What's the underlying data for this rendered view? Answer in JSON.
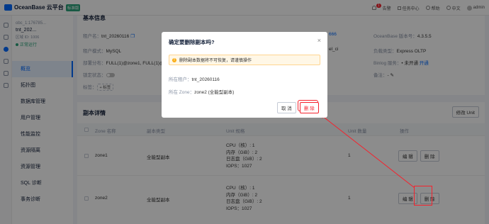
{
  "topbar": {
    "brand": "OceanBase 云平台",
    "edition": "标准版",
    "alerts_label": "告警",
    "alerts_count": "1",
    "tasks_label": "任务中心",
    "help_label": "帮助",
    "lang_label": "中文",
    "user_label": "admin"
  },
  "tenant": {
    "cluster": "obc_1:176785...",
    "name": "tnt_202...",
    "region": "区域 ID: 1006",
    "status": "正常运行"
  },
  "nav": [
    "概览",
    "拓扑图",
    "数据库管理",
    "用户管理",
    "性能监控",
    "资源隔离",
    "资源管理",
    "SQL 诊断",
    "事务诊断"
  ],
  "basic": {
    "section_title": "基本信息",
    "tenant_name_key": "租户名：",
    "tenant_name": "tnt_20260116",
    "mode_key": "租户模式：",
    "mode": "MySQL",
    "deploy_key": "部署分布：",
    "deploy": "FULL(1)@zone1, FULL(1)@",
    "lock_key": "锁定状态：",
    "tags_key": "标签：",
    "tag_btn": "+ 标签",
    "mid1": "666",
    "mid2": "el_ci",
    "version_key": "OceanBase 版本号：",
    "version": "4.3.5.5",
    "load_key": "负载类型：",
    "load": "Express OLTP",
    "binlog_key": "Binlog 服务：",
    "binlog_state": "• 未开通",
    "binlog_link": "开通",
    "remark_key": "备注：",
    "remark": "- ✎"
  },
  "replicas": {
    "title": "副本详情",
    "modify_unit": "修改 Unit",
    "columns": [
      "Zone 名称",
      "副本类型",
      "Unit 规格",
      "Unit 数量",
      "操作"
    ],
    "rows": [
      {
        "zone": "zone1",
        "type": "全能型副本",
        "cpu": "CPU（核）: 1",
        "mem": "内存（GiB）: 2",
        "log": "日志盘（GiB）: 2",
        "iops": "IOPS：1027",
        "count": "1",
        "edit": "编 辑",
        "delete": "删 除"
      },
      {
        "zone": "zone2",
        "type": "全能型副本",
        "cpu": "CPU（核）: 1",
        "mem": "内存（GiB）: 2",
        "log": "日志盘（GiB）: 2",
        "iops": "IOPS：1027",
        "count": "1",
        "edit": "编 辑",
        "delete": "删 除"
      }
    ]
  },
  "modal": {
    "title": "确定要删除副本吗?",
    "close": "×",
    "warning": "删除副本数据将不可恢复，请谨慎操作",
    "tenant_key": "所在租户：",
    "tenant": "tnt_20260116",
    "zone_key": "所在 Zone：",
    "zone": "zone2 (全能型副本)",
    "cancel": "取 消",
    "confirm": "删 除"
  },
  "colors": {
    "primary": "#006aff",
    "danger": "#f5222d",
    "success": "#2aa37a"
  }
}
